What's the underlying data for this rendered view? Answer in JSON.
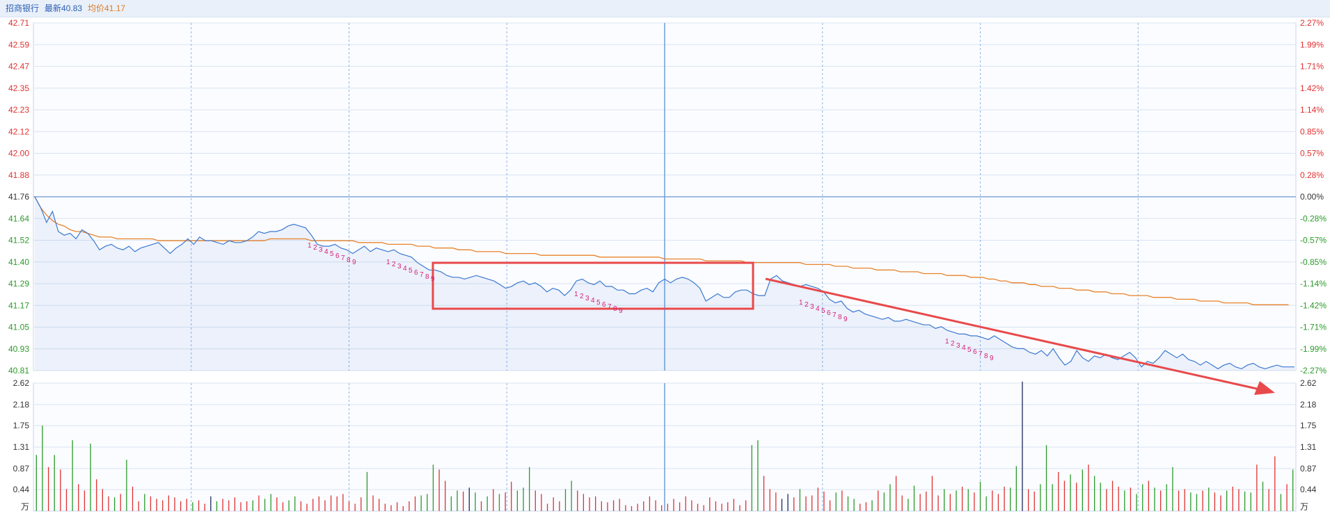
{
  "header": {
    "stock_name": "招商银行",
    "latest_label": "最新40.83",
    "avg_label": "均价41.17"
  },
  "colors": {
    "price_line": "#3a78d0",
    "avg_line": "#e8822a",
    "up": "#e03030",
    "down": "#2a9a2a",
    "neutral": "#1c2a5a",
    "grid": "#d9e4f2",
    "annotation": "#e8494b",
    "tick_label": "#d6217a"
  },
  "chart_data": [
    {
      "type": "line",
      "title": "",
      "y_ticks_left": [
        "42.71",
        "42.59",
        "42.47",
        "42.35",
        "42.23",
        "42.12",
        "42.00",
        "41.88",
        "41.76",
        "41.64",
        "41.52",
        "41.40",
        "41.29",
        "41.17",
        "41.05",
        "40.93",
        "40.81"
      ],
      "y_ticks_right": [
        "2.27%",
        "1.99%",
        "1.71%",
        "1.42%",
        "1.14%",
        "0.85%",
        "0.57%",
        "0.28%",
        "0.00%",
        "-0.28%",
        "-0.57%",
        "-0.85%",
        "-1.14%",
        "-1.42%",
        "-1.71%",
        "-1.99%",
        "-2.27%"
      ],
      "ylim": [
        40.81,
        42.71
      ],
      "prev_close": 41.76,
      "series": [
        {
          "values": [
            41.76,
            41.7,
            41.62,
            41.68,
            41.57,
            41.55,
            41.56,
            41.53,
            41.58,
            41.56,
            41.52,
            41.47,
            41.49,
            41.5,
            41.48,
            41.47,
            41.49,
            41.46,
            41.48,
            41.49,
            41.5,
            41.51,
            41.48,
            41.45,
            41.48,
            41.5,
            41.53,
            41.5,
            41.54,
            41.52,
            41.52,
            41.51,
            41.5,
            41.52,
            41.51,
            41.51,
            41.52,
            41.54,
            41.57,
            41.56,
            41.57,
            41.57,
            41.58,
            41.6,
            41.61,
            41.6,
            41.59,
            41.55,
            41.5,
            41.49,
            41.49,
            41.5,
            41.48,
            41.47,
            41.45,
            41.47,
            41.49,
            41.46,
            41.48,
            41.47,
            41.46,
            41.47,
            41.45,
            41.44,
            41.43,
            41.4,
            41.38,
            41.36,
            41.36,
            41.35,
            41.33,
            41.32,
            41.32,
            41.31,
            41.32,
            41.33,
            41.32,
            41.31,
            41.3,
            41.28,
            41.26,
            41.27,
            41.29,
            41.3,
            41.28,
            41.29,
            41.27,
            41.24,
            41.26,
            41.25,
            41.22,
            41.25,
            41.3,
            41.31,
            41.29,
            41.28,
            41.3,
            41.27,
            41.27,
            41.25,
            41.25,
            41.23,
            41.23,
            41.25,
            41.26,
            41.24,
            41.29,
            41.31,
            41.29,
            41.31,
            41.32,
            41.31,
            41.29,
            41.26,
            41.19,
            41.21,
            41.23,
            41.21,
            41.21,
            41.24,
            41.25,
            41.25,
            41.23,
            41.22,
            41.22,
            41.31,
            41.33,
            41.3,
            41.29,
            41.28,
            41.27,
            41.28,
            41.27,
            41.26,
            41.24,
            41.2,
            41.18,
            41.19,
            41.15,
            41.13,
            41.14,
            41.12,
            41.11,
            41.1,
            41.09,
            41.1,
            41.08,
            41.08,
            41.09,
            41.08,
            41.07,
            41.06,
            41.06,
            41.04,
            41.05,
            41.03,
            41.02,
            41.01,
            41.01,
            41.0,
            41.0,
            40.99,
            40.98,
            41.0,
            40.98,
            40.96,
            40.94,
            40.93,
            40.93,
            40.91,
            40.9,
            40.92,
            40.89,
            40.93,
            40.88,
            40.84,
            40.86,
            40.92,
            40.88,
            40.86,
            40.89,
            40.88,
            40.9,
            40.88,
            40.87,
            40.89,
            40.91,
            40.88,
            40.83,
            40.86,
            40.85,
            40.88,
            40.92,
            40.9,
            40.88,
            40.9,
            40.87,
            40.86,
            40.84,
            40.86,
            40.84,
            40.82,
            40.84,
            40.85,
            40.83,
            40.82,
            40.84,
            40.85,
            40.83,
            40.82,
            40.83,
            40.84,
            40.83,
            40.83,
            40.83
          ]
        },
        {
          "values": [
            41.76,
            41.7,
            41.66,
            41.63,
            41.61,
            41.6,
            41.58,
            41.57,
            41.57,
            41.56,
            41.55,
            41.54,
            41.54,
            41.54,
            41.53,
            41.53,
            41.53,
            41.53,
            41.53,
            41.53,
            41.53,
            41.52,
            41.52,
            41.52,
            41.52,
            41.52,
            41.52,
            41.52,
            41.52,
            41.52,
            41.52,
            41.52,
            41.52,
            41.52,
            41.52,
            41.52,
            41.52,
            41.52,
            41.52,
            41.52,
            41.53,
            41.53,
            41.53,
            41.53,
            41.53,
            41.53,
            41.53,
            41.52,
            41.52,
            41.52,
            41.52,
            41.52,
            41.52,
            41.52,
            41.52,
            41.51,
            41.51,
            41.51,
            41.51,
            41.51,
            41.5,
            41.5,
            41.5,
            41.5,
            41.5,
            41.49,
            41.49,
            41.49,
            41.48,
            41.48,
            41.48,
            41.48,
            41.47,
            41.47,
            41.47,
            41.46,
            41.46,
            41.46,
            41.46,
            41.46,
            41.45,
            41.45,
            41.45,
            41.45,
            41.45,
            41.45,
            41.44,
            41.44,
            41.44,
            41.44,
            41.44,
            41.44,
            41.44,
            41.44,
            41.44,
            41.44,
            41.43,
            41.43,
            41.43,
            41.43,
            41.43,
            41.43,
            41.43,
            41.43,
            41.43,
            41.43,
            41.43,
            41.42,
            41.42,
            41.42,
            41.42,
            41.42,
            41.42,
            41.42,
            41.41,
            41.41,
            41.41,
            41.41,
            41.41,
            41.41,
            41.41,
            41.4,
            41.4,
            41.4,
            41.4,
            41.4,
            41.4,
            41.4,
            41.4,
            41.4,
            41.4,
            41.39,
            41.39,
            41.39,
            41.39,
            41.39,
            41.38,
            41.38,
            41.38,
            41.37,
            41.37,
            41.37,
            41.37,
            41.36,
            41.36,
            41.36,
            41.36,
            41.35,
            41.35,
            41.35,
            41.35,
            41.34,
            41.34,
            41.34,
            41.34,
            41.33,
            41.33,
            41.33,
            41.33,
            41.32,
            41.32,
            41.32,
            41.31,
            41.31,
            41.3,
            41.3,
            41.29,
            41.29,
            41.29,
            41.28,
            41.28,
            41.27,
            41.27,
            41.27,
            41.26,
            41.26,
            41.26,
            41.25,
            41.25,
            41.25,
            41.24,
            41.24,
            41.24,
            41.23,
            41.23,
            41.23,
            41.22,
            41.22,
            41.22,
            41.22,
            41.21,
            41.21,
            41.21,
            41.21,
            41.2,
            41.2,
            41.2,
            41.2,
            41.19,
            41.19,
            41.19,
            41.19,
            41.18,
            41.18,
            41.18,
            41.18,
            41.18,
            41.17,
            41.17,
            41.17,
            41.17,
            41.17,
            41.17,
            41.17
          ]
        }
      ]
    },
    {
      "type": "bar",
      "title": "",
      "y_ticks": [
        "2.62",
        "2.18",
        "1.75",
        "1.31",
        "0.87",
        "0.44",
        "万"
      ],
      "ylim": [
        0,
        2.62
      ],
      "values": [
        1.15,
        1.75,
        0.9,
        1.15,
        0.85,
        0.45,
        1.45,
        0.55,
        0.42,
        1.38,
        0.65,
        0.45,
        0.3,
        0.28,
        0.35,
        1.05,
        0.5,
        0.2,
        0.35,
        0.3,
        0.25,
        0.22,
        0.32,
        0.28,
        0.2,
        0.25,
        0.18,
        0.22,
        0.15,
        0.3,
        0.2,
        0.25,
        0.22,
        0.28,
        0.18,
        0.2,
        0.22,
        0.32,
        0.25,
        0.35,
        0.28,
        0.18,
        0.22,
        0.3,
        0.2,
        0.15,
        0.25,
        0.3,
        0.22,
        0.32,
        0.3,
        0.35,
        0.2,
        0.15,
        0.28,
        0.8,
        0.32,
        0.25,
        0.15,
        0.12,
        0.18,
        0.1,
        0.2,
        0.3,
        0.32,
        0.35,
        0.95,
        0.85,
        0.62,
        0.3,
        0.42,
        0.4,
        0.48,
        0.38,
        0.2,
        0.3,
        0.45,
        0.35,
        0.38,
        0.6,
        0.42,
        0.48,
        0.9,
        0.42,
        0.35,
        0.15,
        0.28,
        0.2,
        0.45,
        0.62,
        0.42,
        0.35,
        0.28,
        0.3,
        0.2,
        0.18,
        0.22,
        0.25,
        0.12,
        0.1,
        0.15,
        0.2,
        0.3,
        0.22,
        0.12,
        0.15,
        0.25,
        0.18,
        0.3,
        0.22,
        0.15,
        0.12,
        0.28,
        0.2,
        0.15,
        0.18,
        0.25,
        0.12,
        0.22,
        1.35,
        1.45,
        0.72,
        0.45,
        0.38,
        0.25,
        0.35,
        0.28,
        0.45,
        0.3,
        0.32,
        0.48,
        0.4,
        0.22,
        0.38,
        0.42,
        0.3,
        0.25,
        0.15,
        0.18,
        0.22,
        0.42,
        0.38,
        0.55,
        0.72,
        0.32,
        0.25,
        0.52,
        0.35,
        0.4,
        0.72,
        0.32,
        0.45,
        0.35,
        0.42,
        0.5,
        0.45,
        0.38,
        0.6,
        0.3,
        0.42,
        0.35,
        0.5,
        0.48,
        0.92,
        2.65,
        0.45,
        0.4,
        0.55,
        1.35,
        0.55,
        0.8,
        0.62,
        0.75,
        0.58,
        0.85,
        0.95,
        0.72,
        0.58,
        0.45,
        0.62,
        0.5,
        0.42,
        0.48,
        0.35,
        0.55,
        0.62,
        0.48,
        0.42,
        0.55,
        0.9,
        0.42,
        0.45,
        0.38,
        0.35,
        0.42,
        0.48,
        0.38,
        0.32,
        0.42,
        0.5,
        0.45,
        0.4,
        0.38,
        0.95,
        0.6,
        0.45,
        1.12,
        0.35,
        0.55,
        0.85
      ],
      "colors": [
        "d",
        "d",
        "u",
        "d",
        "u",
        "u",
        "d",
        "u",
        "u",
        "d",
        "u",
        "u",
        "u",
        "d",
        "u",
        "d",
        "u",
        "u",
        "d",
        "u",
        "u",
        "u",
        "u",
        "u",
        "u",
        "u",
        "d",
        "u",
        "u",
        "n",
        "d",
        "u",
        "u",
        "u",
        "u",
        "u",
        "d",
        "u",
        "d",
        "d",
        "u",
        "u",
        "d",
        "d",
        "u",
        "u",
        "u",
        "u",
        "u",
        "u",
        "u",
        "u",
        "u",
        "u",
        "u",
        "d",
        "u",
        "u",
        "u",
        "u",
        "u",
        "u",
        "u",
        "u",
        "d",
        "d",
        "d",
        "u",
        "u",
        "d",
        "d",
        "u",
        "n",
        "d",
        "u",
        "d",
        "u",
        "d",
        "u",
        "u",
        "d",
        "d",
        "d",
        "u",
        "u",
        "u",
        "u",
        "u",
        "d",
        "d",
        "u",
        "u",
        "u",
        "u",
        "u",
        "u",
        "u",
        "u",
        "u",
        "u",
        "u",
        "u",
        "u",
        "u",
        "u",
        "u",
        "u",
        "u",
        "u",
        "u",
        "u",
        "u",
        "u",
        "u",
        "u",
        "u",
        "u",
        "u",
        "u",
        "d",
        "d",
        "u",
        "u",
        "u",
        "n",
        "n",
        "u",
        "d",
        "u",
        "u",
        "u",
        "u",
        "u",
        "d",
        "u",
        "d",
        "d",
        "u",
        "u",
        "d",
        "u",
        "d",
        "d",
        "u",
        "u",
        "d",
        "d",
        "u",
        "u",
        "u",
        "u",
        "d",
        "u",
        "d",
        "u",
        "d",
        "u",
        "d",
        "d",
        "u",
        "u",
        "u",
        "d",
        "d",
        "n",
        "u",
        "u",
        "d",
        "d",
        "d",
        "u",
        "u",
        "d",
        "u",
        "d",
        "u",
        "d",
        "d",
        "u",
        "u",
        "u",
        "d",
        "u",
        "d",
        "d",
        "u",
        "d",
        "u",
        "d",
        "d",
        "u",
        "u",
        "d",
        "d",
        "u",
        "d",
        "u",
        "u",
        "d",
        "u",
        "u",
        "d",
        "d",
        "u",
        "d",
        "u",
        "u",
        "d",
        "u",
        "d",
        "u",
        "u",
        "d",
        "d",
        "u",
        "n",
        "u",
        "u",
        "d",
        "u",
        "d",
        "u",
        "u",
        "u",
        "n"
      ]
    }
  ]
}
